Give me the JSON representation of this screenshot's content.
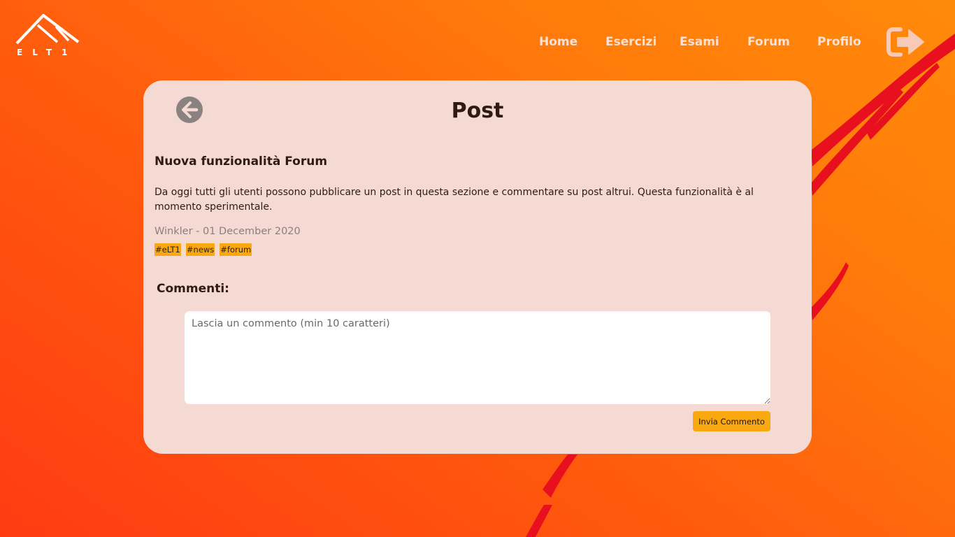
{
  "brand": {
    "logo_text": "ELT1"
  },
  "nav": {
    "items": [
      {
        "label": "Home"
      },
      {
        "label": "Esercizi"
      },
      {
        "label": "Esami"
      },
      {
        "label": "Forum"
      },
      {
        "label": "Profilo"
      }
    ],
    "logout_icon": "sign-out-icon"
  },
  "page": {
    "title": "Post",
    "back_icon": "arrow-circle-left-icon"
  },
  "post": {
    "title": "Nuova funzionalità Forum",
    "body": "Da oggi tutti gli utenti possono pubblicare un post in questa sezione e commentare su post altrui. Questa funzionalità è al momento sperimentale.",
    "meta": "Winkler - 01 December 2020",
    "tags": [
      "#eLT1",
      "#news",
      "#forum"
    ]
  },
  "comments": {
    "heading": "Commenti:",
    "input_value": "",
    "input_placeholder": "Lascia un commento (min 10 caratteri)",
    "submit_label": "Invia Commento"
  },
  "colors": {
    "card_background": "#f5dad4",
    "accent": "#f9a90f",
    "text_dark": "#2e1d0e",
    "nav_text": "#fbe1d8",
    "decor_red": "#e8101e"
  }
}
